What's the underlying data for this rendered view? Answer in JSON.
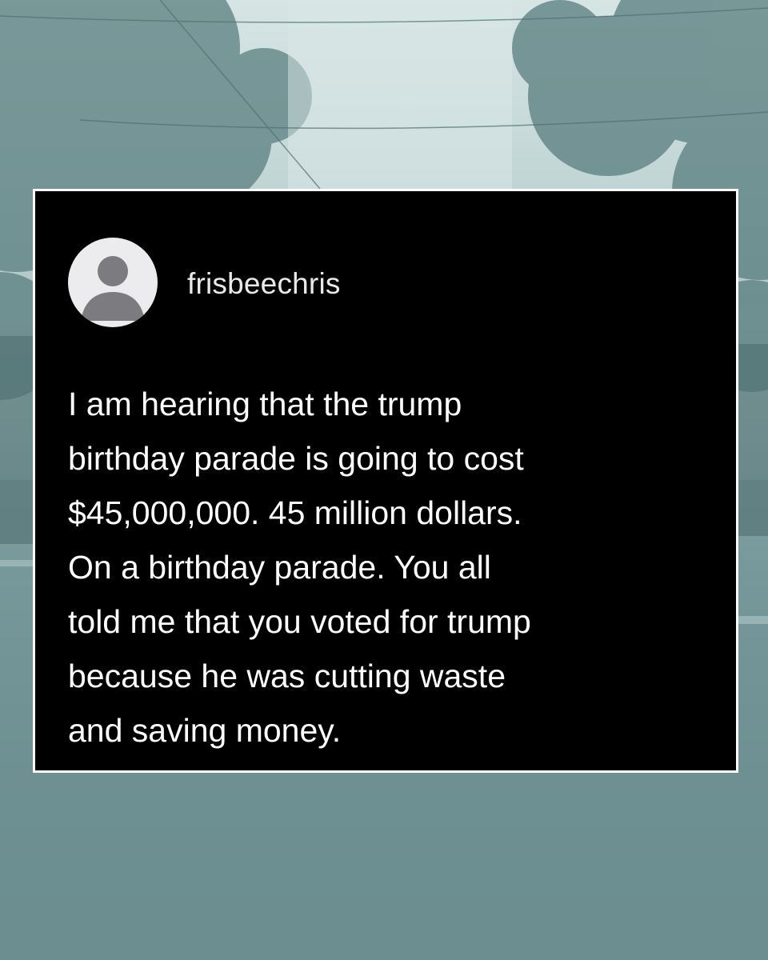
{
  "post": {
    "username": "frisbeechris",
    "avatar_icon": "default-user-icon",
    "text": "I am hearing that the trump\nbirthday parade is going to cost\n$45,000,000. 45 million dollars.\nOn a birthday parade. You all\ntold me that you voted for trump\nbecause he was cutting waste\nand saving money."
  },
  "colors": {
    "card_background": "#000000",
    "card_border": "#ffffff",
    "text": "#ffffff",
    "username": "#e9e9e9",
    "avatar_background": "#ececef",
    "avatar_figure": "#7b7b80",
    "background_tint": "#7fa0a2"
  }
}
